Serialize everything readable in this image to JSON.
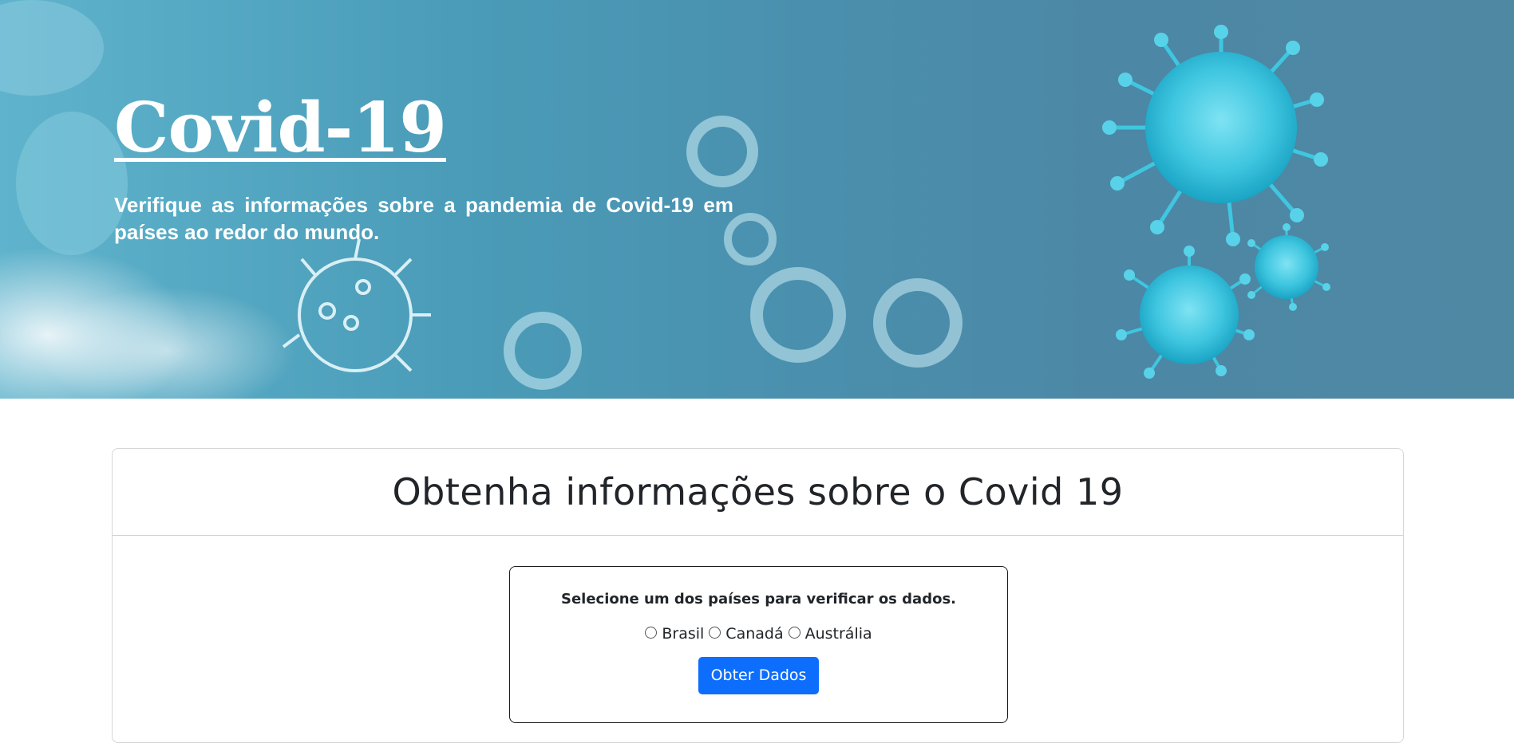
{
  "hero": {
    "title": "Covid-19",
    "subtitle": "Verifique as informações sobre a pandemia de Covid-19 em países ao redor do mundo."
  },
  "card": {
    "title": "Obtenha informações sobre o Covid 19",
    "instruction": "Selecione um dos países para verificar os dados.",
    "options": [
      {
        "label": "Brasil",
        "checked": false
      },
      {
        "label": "Canadá",
        "checked": false
      },
      {
        "label": "Austrália",
        "checked": false
      }
    ],
    "button_label": "Obter Dados"
  },
  "colors": {
    "hero_bg": "#4a8fad",
    "virus": "#3fc6e0",
    "button": "#0d6efd",
    "text_dark": "#212529"
  }
}
